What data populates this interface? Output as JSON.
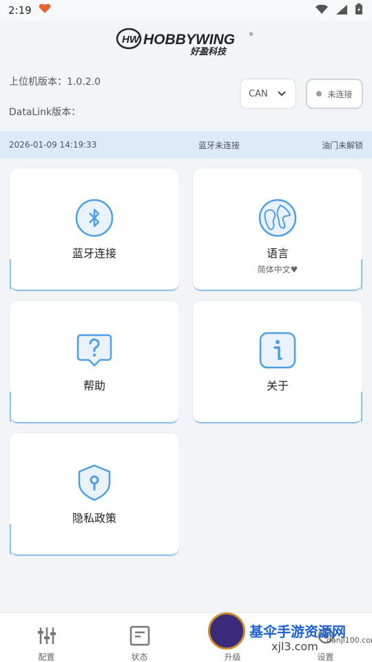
{
  "statusbar": {
    "time": "2:19"
  },
  "info": {
    "host_version_label": "上位机版本：",
    "host_version_value": "1.0.2.0",
    "datalink_label": "DataLink版本："
  },
  "can_select": {
    "value": "CAN"
  },
  "connection": {
    "label": "未连接"
  },
  "strip": {
    "datetime": "2026-01-09 14:19:33",
    "bluetooth_status": "蓝牙未连接",
    "throttle_status": "油门未解锁"
  },
  "cards": {
    "bluetooth": "蓝牙连接",
    "language": "语言",
    "language_value": "简体中文♥",
    "help": "帮助",
    "about": "关于",
    "privacy": "隐私政策"
  },
  "nav": {
    "config": "配置",
    "status": "状态",
    "upgrade": "升级",
    "settings": "设置"
  },
  "watermark": {
    "title": "基伞手游资源网",
    "site": "xjl3.com",
    "site2": "danji100.com"
  },
  "colors": {
    "accent": "#4a9fe8",
    "strip_bg": "#deeafa",
    "card_border": "#8ec2ee"
  }
}
